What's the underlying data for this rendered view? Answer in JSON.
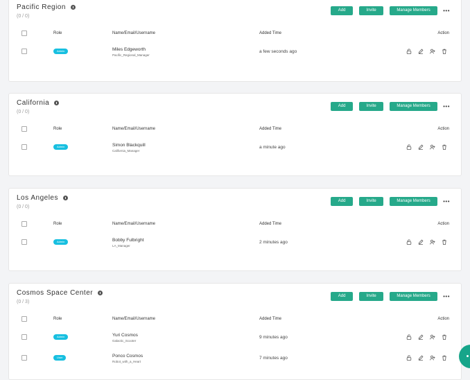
{
  "groups": [
    {
      "title": "Pacific Region",
      "count": "(0 / 0)",
      "headers": {
        "role": "Role",
        "name": "Name/Email/Username",
        "added": "Added Time",
        "action": "Action"
      },
      "buttons": {
        "add": "Add",
        "invite": "Invite",
        "manage": "Manage Members"
      },
      "members": [
        {
          "role": "Admin",
          "name": "Miles Edgeworth",
          "username": "Pacific_Regional_Manager",
          "added": "a few seconds ago"
        }
      ]
    },
    {
      "title": "California",
      "count": "(0 / 0)",
      "headers": {
        "role": "Role",
        "name": "Name/Email/Username",
        "added": "Added Time",
        "action": "Action"
      },
      "buttons": {
        "add": "Add",
        "invite": "Invite",
        "manage": "Manage Members"
      },
      "members": [
        {
          "role": "Admin",
          "name": "Simon Blackquill",
          "username": "California_Manager",
          "added": "a minute ago"
        }
      ]
    },
    {
      "title": "Los Angeles",
      "count": "(0 / 0)",
      "headers": {
        "role": "Role",
        "name": "Name/Email/Username",
        "added": "Added Time",
        "action": "Action"
      },
      "buttons": {
        "add": "Add",
        "invite": "Invite",
        "manage": "Manage Members"
      },
      "members": [
        {
          "role": "Admin",
          "name": "Bobby Fulbright",
          "username": "LA_Manager",
          "added": "2 minutes ago"
        }
      ]
    },
    {
      "title": "Cosmos Space Center",
      "count": "(0 / 3)",
      "headers": {
        "role": "Role",
        "name": "Name/Email/Username",
        "added": "Added Time",
        "action": "Action"
      },
      "buttons": {
        "add": "Add",
        "invite": "Invite",
        "manage": "Manage Members"
      },
      "members": [
        {
          "role": "Admin",
          "name": "Yuri Cosmos",
          "username": "Galactic_Scooter",
          "added": "9 minutes ago"
        },
        {
          "role": "User",
          "name": "Ponco Cosmos",
          "username": "Robot_with_a_Heart",
          "added": "7 minutes ago"
        }
      ]
    }
  ],
  "icons": {
    "info": "info-icon",
    "more": "more-icon",
    "unlock": "unlock-icon",
    "edit": "edit-icon",
    "assign": "assign-user-icon",
    "delete": "trash-icon",
    "chat": "chat-icon"
  },
  "colors": {
    "primary_button": "#26a98a",
    "role_badge": "#17bfe0",
    "chat_fab": "#17a58a"
  }
}
